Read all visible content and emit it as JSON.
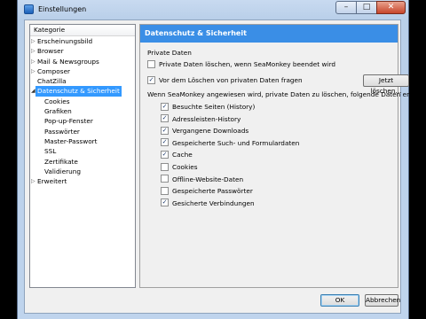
{
  "window": {
    "title": "Einstellungen"
  },
  "sidebar": {
    "header": "Kategorie",
    "items": [
      {
        "label": "Erscheinungsbild",
        "level": 0,
        "expandable": true
      },
      {
        "label": "Browser",
        "level": 0,
        "expandable": true
      },
      {
        "label": "Mail & Newsgroups",
        "level": 0,
        "expandable": true
      },
      {
        "label": "Composer",
        "level": 0,
        "expandable": true
      },
      {
        "label": "ChatZilla",
        "level": 0,
        "expandable": false
      },
      {
        "label": "Datenschutz & Sicherheit",
        "level": 0,
        "expandable": true,
        "expanded": true,
        "selected": true
      },
      {
        "label": "Cookies",
        "level": 1
      },
      {
        "label": "Grafiken",
        "level": 1
      },
      {
        "label": "Pop-up-Fenster",
        "level": 1
      },
      {
        "label": "Passwörter",
        "level": 1
      },
      {
        "label": "Master-Passwort",
        "level": 1
      },
      {
        "label": "SSL",
        "level": 1
      },
      {
        "label": "Zertifikate",
        "level": 1
      },
      {
        "label": "Validierung",
        "level": 1
      },
      {
        "label": "Erweitert",
        "level": 0,
        "expandable": true
      }
    ]
  },
  "panel": {
    "title": "Datenschutz & Sicherheit",
    "group_label": "Private Daten",
    "options": [
      {
        "label": "Private Daten löschen, wenn SeaMonkey beendet wird",
        "checked": false
      },
      {
        "label": "Vor dem Löschen von privaten Daten fragen",
        "checked": true
      }
    ],
    "clear_now_button": "Jetzt löschen...",
    "clear_intro": "Wenn SeaMonkey angewiesen wird, private Daten zu löschen, folgende Daten entfernen:",
    "data_items": [
      {
        "label": "Besuchte Seiten (History)",
        "checked": true
      },
      {
        "label": "Adressleisten-History",
        "checked": true
      },
      {
        "label": "Vergangene Downloads",
        "checked": true
      },
      {
        "label": "Gespeicherte Such- und Formulardaten",
        "checked": true
      },
      {
        "label": "Cache",
        "checked": true
      },
      {
        "label": "Cookies",
        "checked": false
      },
      {
        "label": "Offline-Website-Daten",
        "checked": false
      },
      {
        "label": "Gespeicherte Passwörter",
        "checked": false
      },
      {
        "label": "Gesicherte Verbindungen",
        "checked": true
      }
    ]
  },
  "footer": {
    "ok_label": "OK",
    "cancel_label": "Abbrechen"
  },
  "colors": {
    "accent": "#3a8ee6",
    "selection": "#3399ff"
  }
}
